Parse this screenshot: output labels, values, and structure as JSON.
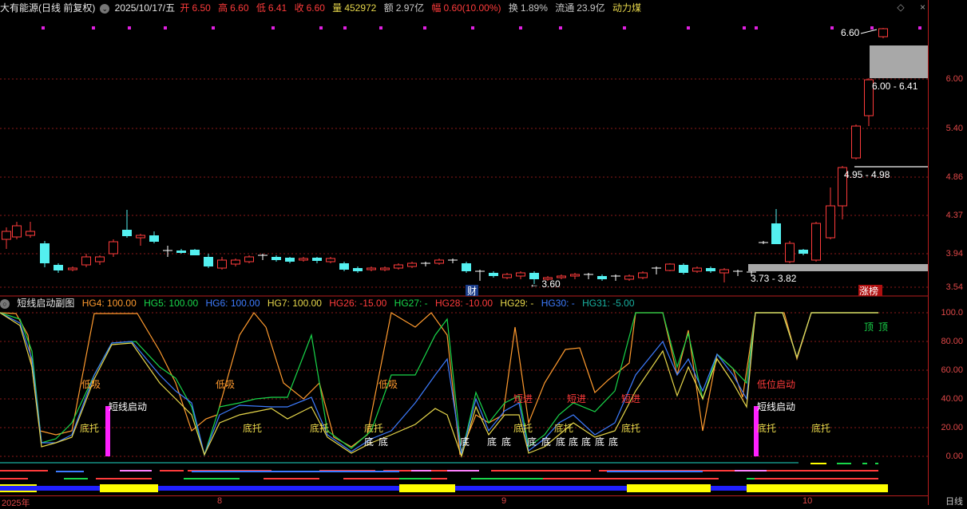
{
  "header": {
    "stock_title": "大有能源(日线 前复权)",
    "date": "2025/10/17/五",
    "open_label": "开",
    "open": "6.50",
    "high_label": "高",
    "high": "6.60",
    "low_label": "低",
    "low": "6.41",
    "close_label": "收",
    "close": "6.60",
    "volume_label": "量",
    "volume": "452972",
    "amount_label": "额",
    "amount": "2.97亿",
    "change_label": "幅",
    "change": "0.60(10.00%)",
    "turnover_label": "换",
    "turnover": "1.89%",
    "float_label": "流通",
    "float_value": "23.9亿",
    "concept": "动力煤",
    "dropdown_icon": "chevron-down-icon"
  },
  "window_controls": {
    "diamond": "◇",
    "close": "×"
  },
  "price_axis": [
    "6.00",
    "5.40",
    "4.86",
    "4.37",
    "3.94",
    "3.54"
  ],
  "price_annotations": {
    "high_marker": "6.60",
    "zone_top": "6.00 - 6.41",
    "zone_mid": "4.95 - 4.98",
    "zone_low": "3.73 - 3.82",
    "low_marker": "3.60",
    "cai": "财",
    "zhangbang": "涨榜"
  },
  "sub_chart": {
    "title": "短线启动副图",
    "params": [
      {
        "label": "HG4: 100.00",
        "color": "#ff9a2e"
      },
      {
        "label": "HG5: 100.00",
        "color": "#19d64a"
      },
      {
        "label": "HG6: 100.00",
        "color": "#3d7cff"
      },
      {
        "label": "HG7: 100.00",
        "color": "#e8d84b"
      },
      {
        "label": "HG26: -15.00",
        "color": "#ff3b3b"
      },
      {
        "label": "HG27: -",
        "color": "#19d64a"
      },
      {
        "label": "HG28: -10.00",
        "color": "#ff3b3b"
      },
      {
        "label": "HG29: -",
        "color": "#e8d84b"
      },
      {
        "label": "HG30: -",
        "color": "#3d7cff"
      },
      {
        "label": "HG31: -5.00",
        "color": "#18b0a0"
      }
    ],
    "axis": [
      "100.0",
      "80.00",
      "60.00",
      "40.00",
      "20.00",
      "0.00"
    ],
    "signals": {
      "dixi": "低吸",
      "duanxian": "短线启动",
      "dituo": "底托",
      "di": "底",
      "duanjin": "短进",
      "diwei": "低位启动",
      "ding": "顶"
    }
  },
  "time_axis": {
    "start": "2025年",
    "m8": "8",
    "m9": "9",
    "m10": "10",
    "period": "日线"
  },
  "colors": {
    "up": "#ff3b3b",
    "down": "#54f0f0",
    "grid": "#8b1a1a",
    "magenta": "#ff20ff"
  }
}
